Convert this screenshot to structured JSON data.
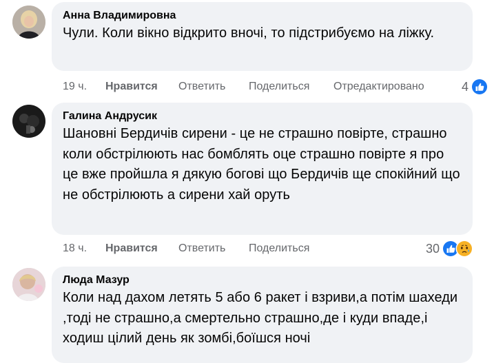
{
  "comments": [
    {
      "author": "Анна Владимировна",
      "text": "Чули. Коли вікно відкрито вночі, то підстрибуємо на ліжку.",
      "time": "19 ч.",
      "like_label": "Нравится",
      "reply_label": "Ответить",
      "share_label": "Поделиться",
      "edited_label": "Отредактировано",
      "reaction_count": "4",
      "reactions": [
        "like-reaction-icon"
      ]
    },
    {
      "author": "Галина Андрусик",
      "text": "Шановні Бердичів сирени - це не страшно повірте, страшно коли обстрілюють нас бомблять оце страшно повірте я про це вже пройшла я дякую богові що Бердичів ще спокійний що не обстрілюють а сирени хай оруть",
      "time": "18 ч.",
      "like_label": "Нравится",
      "reply_label": "Ответить",
      "share_label": "Поделиться",
      "reaction_count": "30",
      "reactions": [
        "like-reaction-icon",
        "sad-reaction-icon"
      ]
    },
    {
      "author": "Люда Мазур",
      "text": "Коли над дахом летять 5 або 6 ракет і взриви,а потім шахеди ,тоді не страшно,а смертельно страшно,де і куди впаде,і ходиш цілий день як зомбі,боїшся ночі"
    }
  ],
  "colors": {
    "bubble": "#f0f2f5",
    "meta_text": "#65676b",
    "like_blue": "#1877f2",
    "sad_yellow": "#f7b125"
  }
}
